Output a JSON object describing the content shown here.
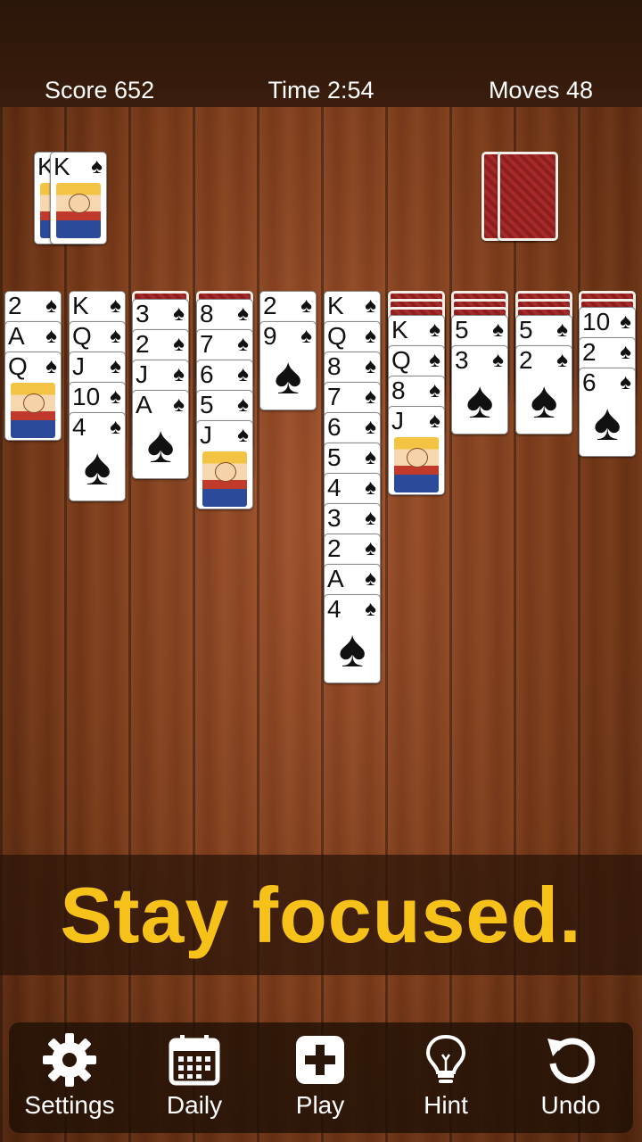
{
  "hud": {
    "score": "Score 652",
    "time": "Time 2:54",
    "moves": "Moves 48"
  },
  "foundation": [
    {
      "rank": "K",
      "suit": "♠"
    },
    {
      "rank": "K",
      "suit": "♠"
    }
  ],
  "columns": [
    {
      "hidden": 0,
      "cards": [
        {
          "rank": "2",
          "suit": "♠"
        },
        {
          "rank": "A",
          "suit": "♠"
        },
        {
          "rank": "Q",
          "suit": "♠",
          "face": true
        }
      ]
    },
    {
      "hidden": 0,
      "cards": [
        {
          "rank": "K",
          "suit": "♠"
        },
        {
          "rank": "Q",
          "suit": "♠"
        },
        {
          "rank": "J",
          "suit": "♠"
        },
        {
          "rank": "10",
          "suit": "♠"
        },
        {
          "rank": "4",
          "suit": "♠"
        }
      ]
    },
    {
      "hidden": 1,
      "cards": [
        {
          "rank": "3",
          "suit": "♠"
        },
        {
          "rank": "2",
          "suit": "♠"
        },
        {
          "rank": "J",
          "suit": "♠"
        },
        {
          "rank": "A",
          "suit": "♠"
        }
      ]
    },
    {
      "hidden": 1,
      "cards": [
        {
          "rank": "8",
          "suit": "♠"
        },
        {
          "rank": "7",
          "suit": "♠"
        },
        {
          "rank": "6",
          "suit": "♠"
        },
        {
          "rank": "5",
          "suit": "♠"
        },
        {
          "rank": "J",
          "suit": "♠",
          "face": true
        }
      ]
    },
    {
      "hidden": 0,
      "cards": [
        {
          "rank": "2",
          "suit": "♠"
        },
        {
          "rank": "9",
          "suit": "♠"
        }
      ]
    },
    {
      "hidden": 0,
      "cards": [
        {
          "rank": "K",
          "suit": "♠"
        },
        {
          "rank": "Q",
          "suit": "♠"
        },
        {
          "rank": "8",
          "suit": "♠"
        },
        {
          "rank": "7",
          "suit": "♠"
        },
        {
          "rank": "6",
          "suit": "♠"
        },
        {
          "rank": "5",
          "suit": "♠"
        },
        {
          "rank": "4",
          "suit": "♠"
        },
        {
          "rank": "3",
          "suit": "♠"
        },
        {
          "rank": "2",
          "suit": "♠"
        },
        {
          "rank": "A",
          "suit": "♠"
        },
        {
          "rank": "4",
          "suit": "♠"
        }
      ]
    },
    {
      "hidden": 3,
      "cards": [
        {
          "rank": "K",
          "suit": "♠"
        },
        {
          "rank": "Q",
          "suit": "♠"
        },
        {
          "rank": "8",
          "suit": "♠"
        },
        {
          "rank": "J",
          "suit": "♠",
          "face": true
        }
      ]
    },
    {
      "hidden": 3,
      "cards": [
        {
          "rank": "5",
          "suit": "♠"
        },
        {
          "rank": "3",
          "suit": "♠"
        }
      ]
    },
    {
      "hidden": 3,
      "cards": [
        {
          "rank": "5",
          "suit": "♠"
        },
        {
          "rank": "2",
          "suit": "♠"
        }
      ]
    },
    {
      "hidden": 2,
      "cards": [
        {
          "rank": "10",
          "suit": "♠"
        },
        {
          "rank": "2",
          "suit": "♠"
        },
        {
          "rank": "6",
          "suit": "♠"
        }
      ]
    }
  ],
  "banner": "Stay focused.",
  "toolbar": [
    {
      "label": "Settings",
      "icon": "gear-icon"
    },
    {
      "label": "Daily",
      "icon": "calendar-icon"
    },
    {
      "label": "Play",
      "icon": "plus-icon"
    },
    {
      "label": "Hint",
      "icon": "lightbulb-icon"
    },
    {
      "label": "Undo",
      "icon": "undo-icon"
    }
  ],
  "colors": {
    "banner_text": "#f6c21a",
    "card_back": "#a52a2a",
    "wood": "#7a3a19"
  }
}
